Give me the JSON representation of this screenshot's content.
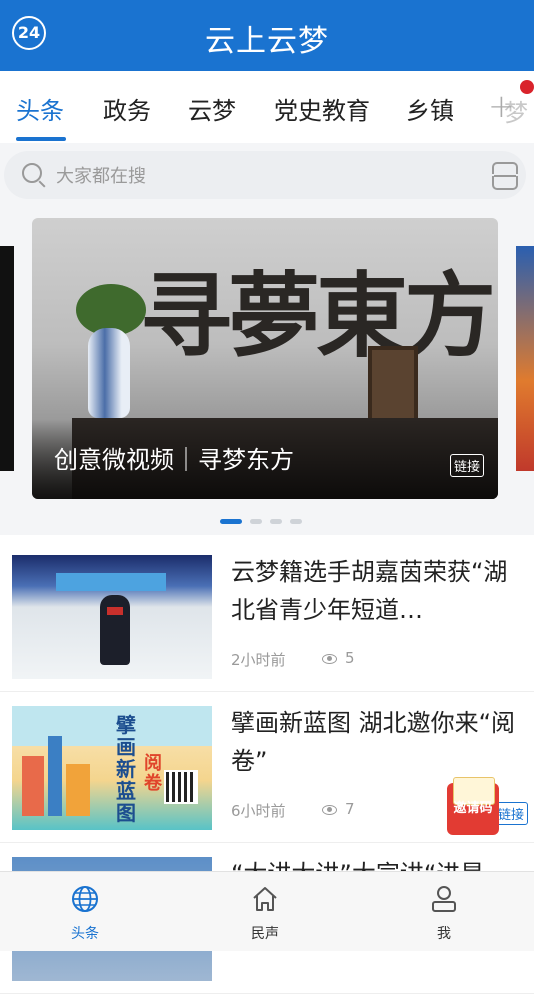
{
  "app": {
    "title": "云上云梦",
    "logo_text": "24"
  },
  "tabs": [
    {
      "label": "头条",
      "active": true
    },
    {
      "label": "政务"
    },
    {
      "label": "云梦"
    },
    {
      "label": "党史教育"
    },
    {
      "label": "乡镇"
    }
  ],
  "tab_more": {
    "icon": "plus-icon",
    "has_notification": true
  },
  "search": {
    "placeholder": "大家都在搜"
  },
  "carousel": {
    "caption": "创意微视频｜寻梦东方",
    "tag": "链接",
    "slide_artwork": "寻夢東方",
    "page_count": 4,
    "active_index": 0
  },
  "news": [
    {
      "headline": "云梦籍选手胡嘉茵荣获“湖北省青少年短道…",
      "time": "2小时前",
      "views": "5"
    },
    {
      "headline": "擘画新蓝图 湖北邀你来“阅卷”",
      "time": "6小时前",
      "views": "7",
      "tag": "链接"
    },
    {
      "headline": "“大讲大讲”大宣讲“进是"
    }
  ],
  "invite": {
    "label": "邀请码"
  },
  "bottom_nav": [
    {
      "label": "头条",
      "icon": "globe-icon",
      "active": true
    },
    {
      "label": "民声",
      "icon": "home-icon"
    },
    {
      "label": "我",
      "icon": "user-icon"
    }
  ],
  "colors": {
    "brand": "#1a73d0",
    "notification": "#d9232b",
    "invite": "#e23b33"
  }
}
